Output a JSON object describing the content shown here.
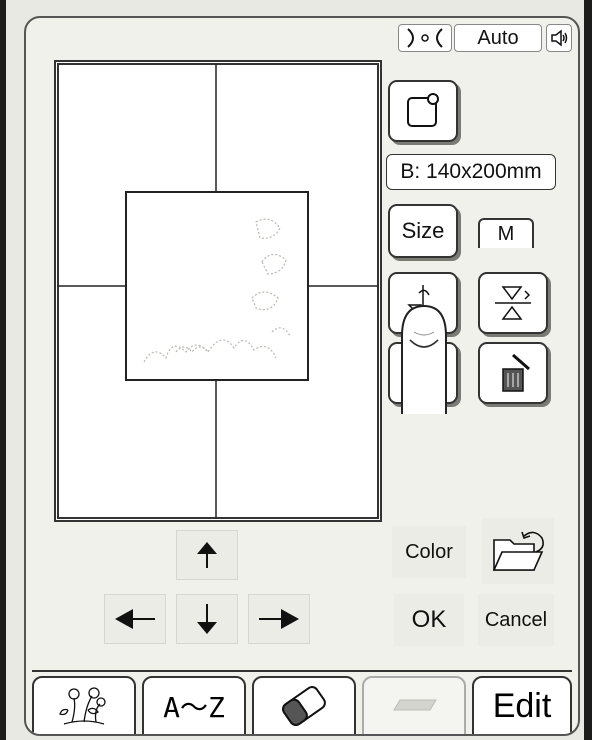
{
  "header": {
    "thread_mode_label": "Auto",
    "thread_icon": "thread-cutter-icon",
    "speaker_icon": "speaker-icon"
  },
  "side_panel": {
    "frame_size_label": "B: 140x200mm",
    "size_button_label": "Size",
    "size_value": "M",
    "color_button_label": "Color",
    "ok_button_label": "OK",
    "cancel_button_label": "Cancel"
  },
  "tabs": [
    {
      "name": "embroidery-patterns",
      "label": ""
    },
    {
      "name": "alphabet",
      "label": "A～Z"
    },
    {
      "name": "eraser",
      "label": ""
    },
    {
      "name": "blank",
      "label": ""
    },
    {
      "name": "edit",
      "label": "Edit"
    }
  ],
  "colors": {
    "screen_bg": "#f1f1ec",
    "button_bg": "#ffffff",
    "border": "#333333",
    "shadow": "#7b7b76"
  }
}
